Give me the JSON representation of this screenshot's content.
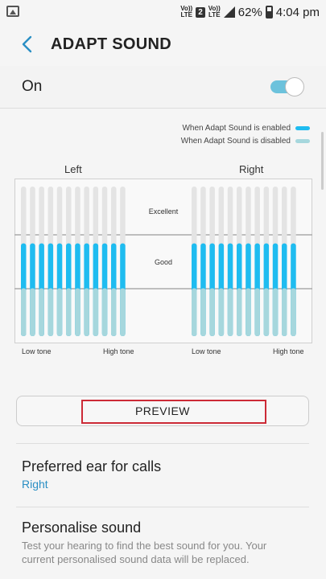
{
  "status_bar": {
    "volte": "Vo))",
    "lte1": "LTE",
    "sim_slot": "2",
    "volte2": "Vo))",
    "lte2": "LTE",
    "battery_percent": "62%",
    "time": "4:04 pm"
  },
  "app_bar": {
    "title": "ADAPT SOUND"
  },
  "master_switch": {
    "label": "On",
    "state": "on"
  },
  "legend": {
    "enabled_label": "When Adapt Sound is enabled",
    "disabled_label": "When Adapt Sound is disabled",
    "enabled_color": "#1fbcf0",
    "disabled_color": "#a6d7dd"
  },
  "chart_data": {
    "type": "bar",
    "panels": [
      "Left",
      "Right"
    ],
    "levels": [
      "Excellent",
      "Good"
    ],
    "x_labels": [
      "Low tone",
      "High tone"
    ],
    "bars_per_panel": 12,
    "enabled_fraction": [
      0.62,
      0.62,
      0.62,
      0.62,
      0.62,
      0.62,
      0.62,
      0.62,
      0.62,
      0.62,
      0.62,
      0.62
    ],
    "disabled_fraction": [
      0.32,
      0.32,
      0.32,
      0.32,
      0.32,
      0.32,
      0.32,
      0.32,
      0.32,
      0.32,
      0.32,
      0.32
    ]
  },
  "preview_button": {
    "label": "PREVIEW"
  },
  "preferred_ear": {
    "title": "Preferred ear for calls",
    "value": "Right"
  },
  "personalise": {
    "title": "Personalise sound",
    "description": "Test your hearing to find the best sound for you. Your current personalised sound data will be replaced."
  }
}
